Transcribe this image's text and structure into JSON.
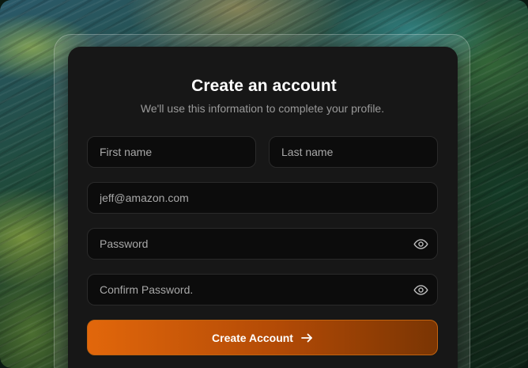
{
  "form": {
    "title": "Create an account",
    "subtitle": "We'll use this information to complete your profile.",
    "first_name_placeholder": "First name",
    "last_name_placeholder": "Last name",
    "email_placeholder": "jeff@amazon.com",
    "password_placeholder": "Password",
    "confirm_password_placeholder": "Confirm Password.",
    "submit_label": "Create Account"
  },
  "icons": {
    "password_toggle": "eye-icon",
    "confirm_toggle": "eye-icon",
    "submit": "arrow-right-icon"
  },
  "colors": {
    "card_background": "#171717",
    "field_background": "#0c0c0c",
    "accent_start": "#e2670b",
    "accent_end": "#7a3503"
  }
}
